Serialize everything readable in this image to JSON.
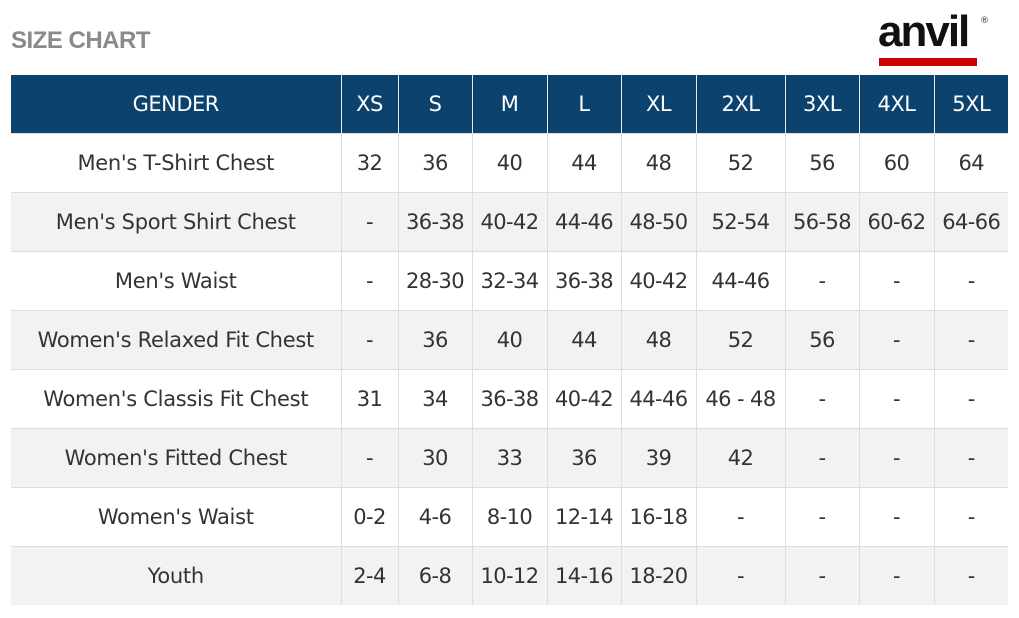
{
  "page": {
    "title": "SIZE CHART",
    "brand": {
      "name": "anvil",
      "registered_mark": "®",
      "underline_color": "#cc0000"
    }
  },
  "colors": {
    "header_bg": "#0b426e",
    "header_text": "#ffffff",
    "row_alt_bg": "#f2f2f2",
    "body_text": "#333333"
  },
  "table": {
    "headers": [
      "GENDER",
      "XS",
      "S",
      "M",
      "L",
      "XL",
      "2XL",
      "3XL",
      "4XL",
      "5XL"
    ],
    "rows": [
      {
        "label": "Men's T-Shirt Chest",
        "values": [
          "32",
          "36",
          "40",
          "44",
          "48",
          "52",
          "56",
          "60",
          "64"
        ]
      },
      {
        "label": "Men's Sport Shirt Chest",
        "values": [
          "-",
          "36-38",
          "40-42",
          "44-46",
          "48-50",
          "52-54",
          "56-58",
          "60-62",
          "64-66"
        ]
      },
      {
        "label": "Men's Waist",
        "values": [
          "-",
          "28-30",
          "32-34",
          "36-38",
          "40-42",
          "44-46",
          "-",
          "-",
          "-"
        ]
      },
      {
        "label": "Women's Relaxed Fit Chest",
        "values": [
          "-",
          "36",
          "40",
          "44",
          "48",
          "52",
          "56",
          "-",
          "-"
        ]
      },
      {
        "label": "Women's Classis Fit Chest",
        "values": [
          "31",
          "34",
          "36-38",
          "40-42",
          "44-46",
          "46 - 48",
          "-",
          "-",
          "-"
        ]
      },
      {
        "label": "Women's Fitted Chest",
        "values": [
          "-",
          "30",
          "33",
          "36",
          "39",
          "42",
          "-",
          "-",
          "-"
        ]
      },
      {
        "label": "Women's Waist",
        "values": [
          "0-2",
          "4-6",
          "8-10",
          "12-14",
          "16-18",
          "-",
          "-",
          "-",
          "-"
        ]
      },
      {
        "label": "Youth",
        "values": [
          "2-4",
          "6-8",
          "10-12",
          "14-16",
          "18-20",
          "-",
          "-",
          "-",
          "-"
        ]
      }
    ]
  }
}
